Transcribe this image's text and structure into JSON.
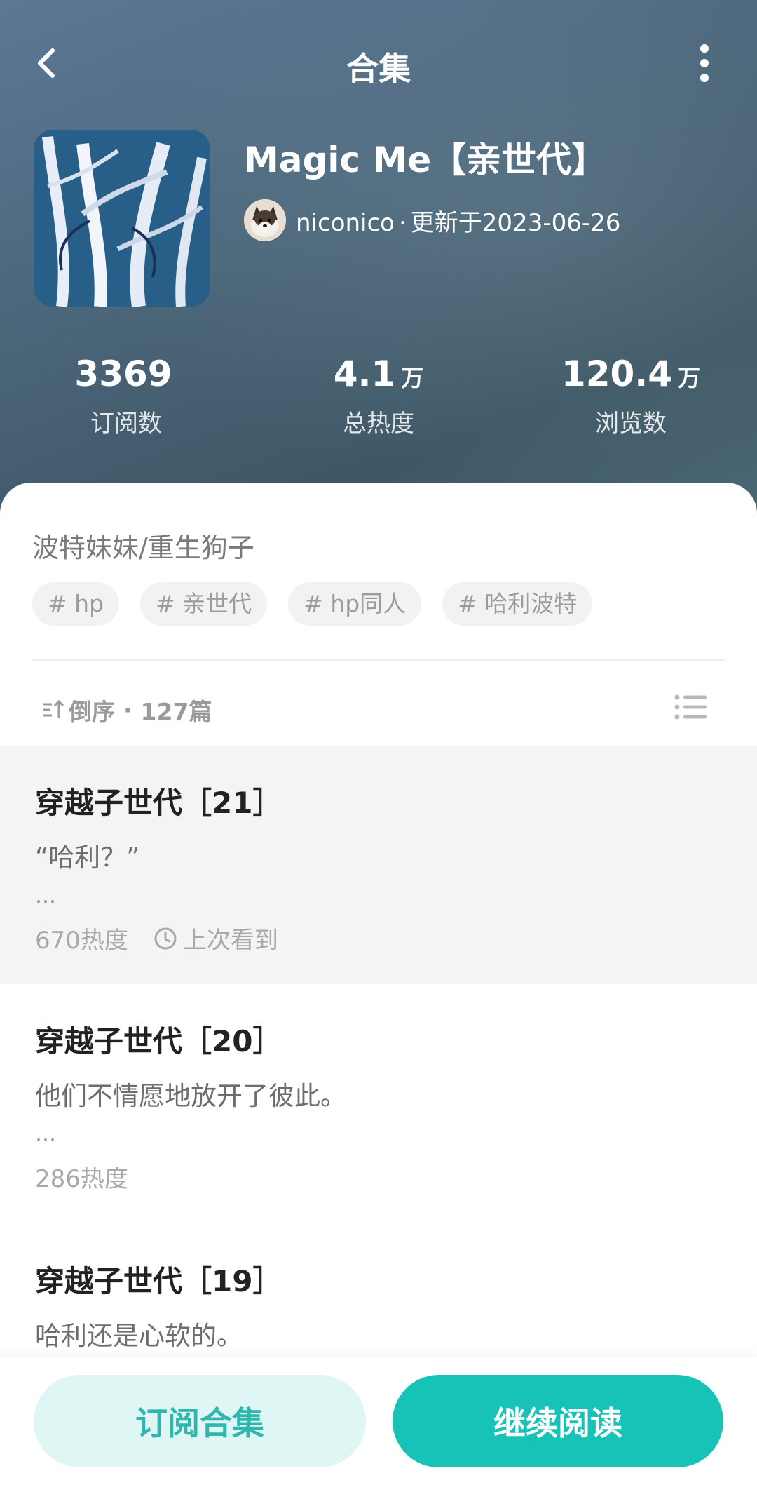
{
  "header": {
    "title": "合集",
    "back_icon": "chevron-left-icon",
    "more_icon": "more-vertical-icon"
  },
  "collection": {
    "title": "Magic Me【亲世代】",
    "author": "niconico",
    "separator": "·",
    "updated": "更新于2023-06-26",
    "description": "波特妹妹/重生狗子",
    "tags": [
      "# hp",
      "# 亲世代",
      "# hp同人",
      "# 哈利波特"
    ]
  },
  "stats": [
    {
      "value": "3369",
      "unit": "",
      "label": "订阅数"
    },
    {
      "value": "4.1",
      "unit": "万",
      "label": "总热度"
    },
    {
      "value": "120.4",
      "unit": "万",
      "label": "浏览数"
    }
  ],
  "list_header": {
    "sort_label": "倒序",
    "dot": "·",
    "count": "127篇"
  },
  "chapters": [
    {
      "title": "穿越子世代［21］",
      "excerpt": "“哈利？”",
      "ellipsis": "…",
      "heat": "670热度",
      "last_read": "上次看到"
    },
    {
      "title": "穿越子世代［20］",
      "excerpt": "他们不情愿地放开了彼此。",
      "ellipsis": "…",
      "heat": "286热度"
    },
    {
      "title": "穿越子世代［19］",
      "excerpt": "哈利还是心软的。"
    }
  ],
  "actions": {
    "subscribe": "订阅合集",
    "continue": "继续阅读"
  },
  "colors": {
    "accent": "#17c2b6",
    "accent_light": "#dff6f5"
  }
}
